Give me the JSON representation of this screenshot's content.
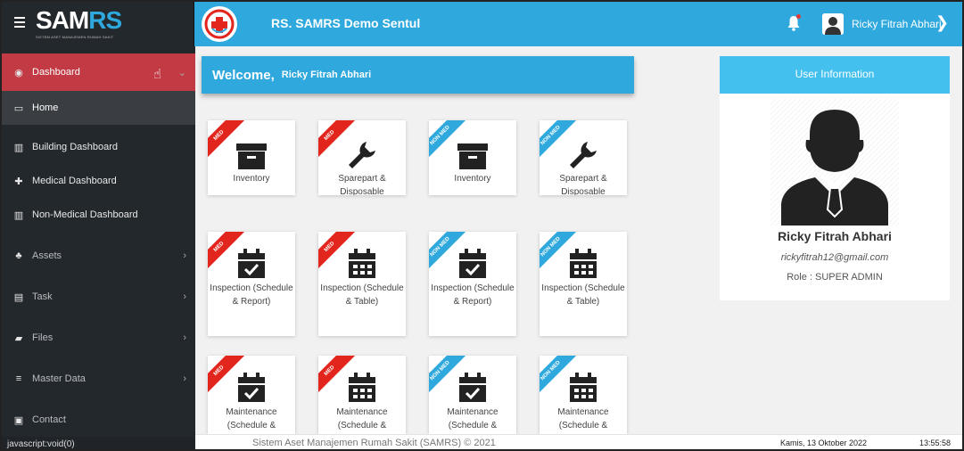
{
  "brand": {
    "logo_a": "SAM",
    "logo_b": "RS",
    "logo_sub": "SISTEM ASET MANAJEMEN RUMAH SAKIT"
  },
  "header": {
    "hospital": "RS. SAMRS Demo Sentul",
    "user": "Ricky Fitrah Abhari"
  },
  "sidebar": {
    "dashboard": "Dashboard",
    "home": "Home",
    "building": "Building Dashboard",
    "medical": "Medical Dashboard",
    "nonmedical": "Non-Medical Dashboard",
    "assets": "Assets",
    "task": "Task",
    "files": "Files",
    "master": "Master Data",
    "contact": "Contact",
    "status_url": "javascript:void(0)"
  },
  "welcome": {
    "title": "Welcome,",
    "name": "Ricky Fitrah Abhari"
  },
  "ribbons": {
    "med": "MED",
    "nonmed": "NON MED"
  },
  "cards": {
    "r1": [
      "Inventory",
      "Sparepart & Disposable",
      "Inventory",
      "Sparepart & Disposable"
    ],
    "r2": [
      "Inspection (Schedule & Report)",
      "Inspection (Schedule & Table)",
      "Inspection (Schedule & Report)",
      "Inspection (Schedule & Table)"
    ],
    "r3": [
      "Maintenance (Schedule &",
      "Maintenance (Schedule &",
      "Maintenance (Schedule &",
      "Maintenance (Schedule &"
    ]
  },
  "user_info": {
    "header": "User Information",
    "name": "Ricky Fitrah Abhari",
    "email": "rickyfitrah12@gmail.com",
    "role": "Role : SUPER ADMIN"
  },
  "footer": {
    "copyright": "Sistem Aset Manajemen Rumah Sakit (SAMRS) © 2021",
    "date": "Kamis, 13 Oktober 2022",
    "time": "13:55:58"
  },
  "colors": {
    "primary": "#2ea8dd",
    "danger": "#e3261d",
    "sidebar": "#23282d",
    "active": "#c23a44"
  }
}
